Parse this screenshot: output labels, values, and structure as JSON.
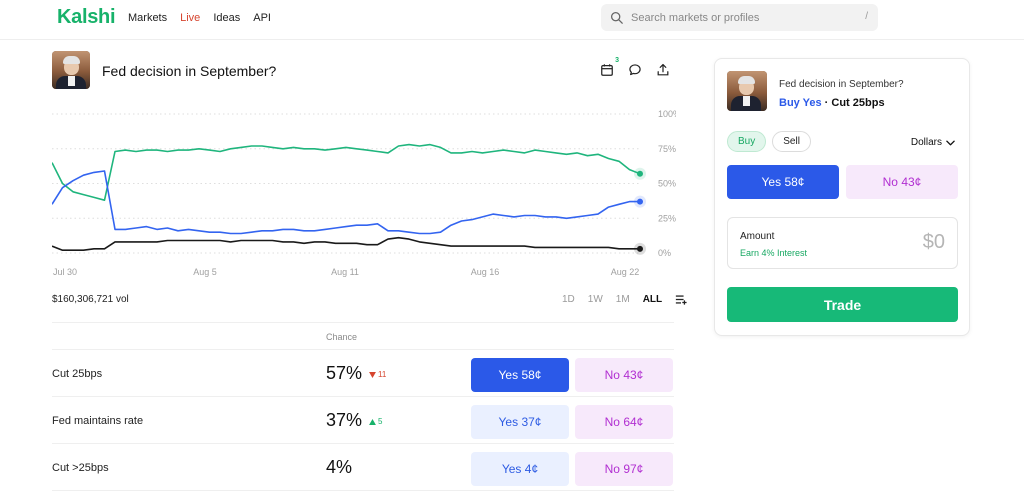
{
  "header": {
    "logo": "Kalshi",
    "nav": [
      "Markets",
      "Live",
      "Ideas",
      "API"
    ],
    "search_placeholder": "Search markets or profiles",
    "search_shortcut": "/"
  },
  "market": {
    "title": "Fed decision in September?",
    "calendar_badge": "3"
  },
  "chart_data": {
    "type": "line",
    "x_ticks": [
      "Jul 30",
      "Aug 5",
      "Aug 11",
      "Aug 16",
      "Aug 22"
    ],
    "y_ticks": [
      "100%",
      "75%",
      "50%",
      "25%",
      "0%"
    ],
    "ylim": [
      0,
      100
    ],
    "grid": true,
    "series": [
      {
        "color": "#1fb57d",
        "values": [
          65,
          50,
          44,
          42,
          40,
          38,
          73,
          74,
          73,
          74,
          74,
          73,
          74,
          74,
          75,
          74,
          73,
          75,
          76,
          77,
          77,
          76,
          75,
          76,
          75,
          75,
          74,
          75,
          76,
          75,
          74,
          73,
          72,
          77,
          78,
          77,
          78,
          76,
          72,
          72,
          73,
          72,
          73,
          74,
          73,
          72,
          74,
          73,
          72,
          71,
          72,
          70,
          71,
          68,
          66,
          60,
          57
        ]
      },
      {
        "color": "#3364f0",
        "values": [
          35,
          47,
          52,
          56,
          58,
          59,
          17,
          17,
          18,
          19,
          17,
          18,
          16,
          17,
          16,
          15,
          15,
          14,
          14,
          15,
          16,
          16,
          17,
          17,
          16,
          16,
          17,
          18,
          19,
          20,
          20,
          21,
          16,
          16,
          15,
          14,
          14,
          15,
          20,
          23,
          24,
          26,
          28,
          27,
          26,
          27,
          27,
          26,
          26,
          25,
          26,
          27,
          28,
          33,
          35,
          37,
          37
        ]
      },
      {
        "color": "#1a1a1a",
        "values": [
          5,
          2,
          2,
          2,
          3,
          3,
          8,
          8,
          8,
          8,
          8,
          9,
          9,
          9,
          9,
          9,
          9,
          8,
          9,
          9,
          9,
          9,
          8,
          8,
          7,
          8,
          8,
          7,
          7,
          7,
          6,
          6,
          10,
          11,
          10,
          8,
          7,
          6,
          5,
          5,
          5,
          5,
          5,
          5,
          5,
          5,
          4,
          4,
          4,
          4,
          4,
          4,
          4,
          4,
          3,
          3,
          3
        ]
      }
    ]
  },
  "stats": {
    "volume": "$160,306,721 vol",
    "ranges": [
      "1D",
      "1W",
      "1M",
      "ALL"
    ],
    "active_range": "ALL"
  },
  "outcomes_header": {
    "chance_label": "Chance"
  },
  "outcomes": [
    {
      "name": "Cut 25bps",
      "chance": "57%",
      "delta": "11",
      "direction": "down",
      "yes": "Yes 58¢",
      "no": "No 43¢"
    },
    {
      "name": "Fed maintains rate",
      "chance": "37%",
      "delta": "5",
      "direction": "up",
      "yes": "Yes 37¢",
      "no": "No 64¢"
    },
    {
      "name": "Cut >25bps",
      "chance": "4%",
      "delta": "",
      "direction": "",
      "yes": "Yes 4¢",
      "no": "No 97¢"
    }
  ],
  "panel": {
    "market_title": "Fed decision in September?",
    "side": "Buy Yes",
    "outcome": "· Cut 25bps",
    "tabs": [
      "Buy",
      "Sell"
    ],
    "currency": "Dollars",
    "yes": "Yes 58¢",
    "no": "No 43¢",
    "amount_label": "Amount",
    "interest": "Earn 4% Interest",
    "amount_value": "$0",
    "trade_label": "Trade"
  }
}
